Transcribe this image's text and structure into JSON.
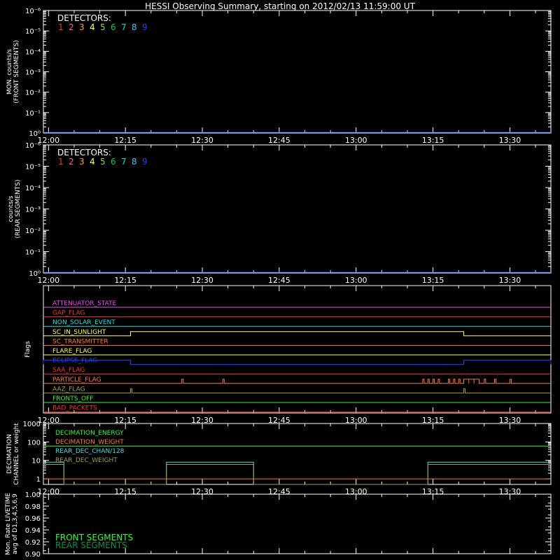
{
  "title": "HESSI Observing Summary, starting on 2012/02/13 11:59:00 UT",
  "colors": {
    "background": "#000000",
    "axes": "#ffffff",
    "det1": "#ff3030",
    "det2": "#ff5a9a",
    "det3": "#ff9a30",
    "det4": "#ffff60",
    "det5": "#9acd32",
    "det6": "#00d050",
    "det7": "#20d8b0",
    "det8": "#40c8ff",
    "det9": "#2040ff"
  },
  "chart_data": [
    {
      "type": "line",
      "name": "front-segments-panel",
      "ylabel": "MON. counts/s\n(FRONT SEGMENTS)",
      "yscale": "log",
      "ylim": [
        1,
        1000000
      ],
      "yticks": [
        "10⁰",
        "10⁻¹",
        "10⁻²",
        "10⁻³",
        "10⁻⁴",
        "10⁻⁵",
        "10⁻⁶"
      ],
      "xticks": [
        "12:00",
        "12:15",
        "12:30",
        "12:45",
        "13:00",
        "13:15",
        "13:30"
      ],
      "xlim": [
        "11:59",
        "13:38"
      ],
      "legend_title": "DETECTORS:",
      "legend": [
        "1",
        "2",
        "3",
        "4",
        "5",
        "6",
        "7",
        "8",
        "9"
      ],
      "series": [
        {
          "name": "9",
          "color": "#2040ff",
          "x": [
            "11:59",
            "13:38"
          ],
          "y": [
            1,
            1
          ]
        }
      ]
    },
    {
      "type": "line",
      "name": "rear-segments-panel",
      "ylabel": "counts/s\n(REAR SEGMENTS)",
      "yscale": "log",
      "ylim": [
        1,
        1000000
      ],
      "yticks": [
        "10⁰",
        "10⁻¹",
        "10⁻²",
        "10⁻³",
        "10⁻⁴",
        "10⁻⁵",
        "10⁻⁶"
      ],
      "xticks": [
        "12:00",
        "12:15",
        "12:30",
        "12:45",
        "13:00",
        "13:15",
        "13:30"
      ],
      "xlim": [
        "11:59",
        "13:38"
      ],
      "legend_title": "DETECTORS:",
      "legend": [
        "1",
        "2",
        "3",
        "4",
        "5",
        "6",
        "7",
        "8",
        "9"
      ],
      "series": [
        {
          "name": "9",
          "color": "#2040ff",
          "x": [
            "11:59",
            "13:38"
          ],
          "y": [
            1,
            1
          ]
        }
      ]
    },
    {
      "type": "line",
      "name": "flags-panel",
      "ylabel": "Flags",
      "xticks": [
        "12:00",
        "12:15",
        "12:30",
        "12:45",
        "13:00",
        "13:15",
        "13:30"
      ],
      "xlim": [
        "11:59",
        "13:38"
      ],
      "flags": [
        {
          "label": "ATTENUATOR_STATE",
          "color": "#ff40ff",
          "on": []
        },
        {
          "label": "GAP_FLAG",
          "color": "#ff3030",
          "on": []
        },
        {
          "label": "NON_SOLAR_EVENT",
          "color": "#20e0e0",
          "on": []
        },
        {
          "label": "SC_IN_SUNLIGHT",
          "color": "#ffff40",
          "on": [
            [
              "12:16",
              "13:21"
            ]
          ]
        },
        {
          "label": "SC_TRANSMITTER",
          "color": "#ff7a30",
          "on": []
        },
        {
          "label": "FLARE_FLAG",
          "color": "#ffff40",
          "on": []
        },
        {
          "label": "ECLIPSE_FLAG",
          "color": "#2040ff",
          "on": [
            [
              "11:59",
              "12:16"
            ],
            [
              "13:21",
              "13:38"
            ]
          ]
        },
        {
          "label": "SAA_FLAG",
          "color": "#ff3030",
          "on": []
        },
        {
          "label": "PARTICLE_FLAG",
          "color": "#ff7a30",
          "on": [
            [
              "12:26",
              "12:26"
            ],
            [
              "12:34",
              "12:34"
            ],
            [
              "13:13",
              "13:13"
            ],
            [
              "13:14",
              "13:14"
            ],
            [
              "13:15",
              "13:15"
            ],
            [
              "13:16",
              "13:16"
            ],
            [
              "13:18",
              "13:18"
            ],
            [
              "13:19",
              "13:19"
            ],
            [
              "13:20",
              "13:20"
            ],
            [
              "13:21",
              "13:22"
            ],
            [
              "13:22",
              "13:23"
            ],
            [
              "13:23",
              "13:24"
            ],
            [
              "13:25",
              "13:25"
            ],
            [
              "13:27",
              "13:27"
            ],
            [
              "13:30",
              "13:30"
            ]
          ]
        },
        {
          "label": "AAZ_FLAG",
          "color": "#a0a040",
          "on": [
            [
              "12:16",
              "12:16"
            ],
            [
              "13:21",
              "13:21"
            ]
          ]
        },
        {
          "label": "FRONTS_OFF",
          "color": "#30ff30",
          "on": []
        },
        {
          "label": "BAD_PACKETS",
          "color": "#ff3030",
          "on": []
        }
      ]
    },
    {
      "type": "line",
      "name": "decimation-panel",
      "ylabel": "DECIMATION\nCHANNEL or weight",
      "yscale": "log",
      "ylim": [
        0.5,
        1000
      ],
      "yticks": [
        "1",
        "10",
        "100",
        "1000"
      ],
      "xticks": [
        "12:00",
        "12:15",
        "12:30",
        "12:45",
        "13:00",
        "13:15",
        "13:30"
      ],
      "xlim": [
        "11:59",
        "13:38"
      ],
      "series": [
        {
          "name": "DECIMATION_ENERGY",
          "color": "#30ff30",
          "x": [
            "11:59",
            "13:38"
          ],
          "y": [
            60,
            60
          ]
        },
        {
          "name": "DECIMATION_WEIGHT",
          "color": "#ff7a30",
          "x": [
            "11:59",
            "12:23",
            "12:23",
            "13:38"
          ],
          "y": [
            1,
            1,
            1,
            1
          ]
        },
        {
          "name": "REAR_DEC_CHAN/128",
          "color": "#40e0e0",
          "x": [
            "11:59",
            "12:03",
            "12:03",
            "12:23",
            "12:23",
            "12:40",
            "12:40",
            "13:14",
            "13:14",
            "13:38"
          ],
          "y": [
            8,
            8,
            0.5,
            0.5,
            8,
            8,
            0.5,
            0.5,
            8,
            8
          ]
        },
        {
          "name": "REAR_DEC_WEIGHT",
          "color": "#a0a040",
          "x": [
            "11:59",
            "12:03",
            "12:03",
            "12:23",
            "12:23",
            "12:40",
            "12:40",
            "13:14",
            "13:14",
            "13:38"
          ],
          "y": [
            6,
            6,
            0.5,
            0.5,
            6,
            6,
            0.5,
            0.5,
            6,
            6
          ]
        }
      ]
    },
    {
      "type": "line",
      "name": "livetime-panel",
      "ylabel": "Mon. Rate LIVETIME\navg of D1,3,4,5,6,9",
      "ylim": [
        0.9,
        1.0
      ],
      "yticks": [
        "0.90",
        "0.92",
        "0.94",
        "0.96",
        "0.98",
        "1.00"
      ],
      "xlim": [
        "11:59",
        "13:38"
      ],
      "legend": [
        {
          "label": "FRONT SEGMENTS",
          "color": "#30ff30"
        },
        {
          "label": "REAR SEGMENTS",
          "color": "#109040"
        }
      ],
      "series": []
    }
  ]
}
